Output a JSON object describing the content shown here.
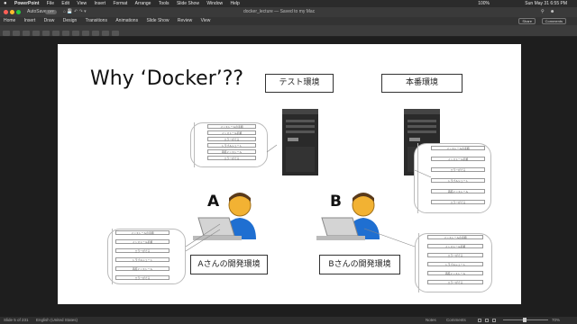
{
  "menubar": {
    "apple": "",
    "app": "PowerPoint",
    "items": [
      "File",
      "Edit",
      "View",
      "Insert",
      "Format",
      "Arrange",
      "Tools",
      "Slide Show",
      "Window",
      "Help"
    ],
    "clock": "Sun May 31 6:55 PM",
    "battery": "100%"
  },
  "titlebar": {
    "autosave": "AutoSave",
    "toggle": "OFF",
    "doc_title": "docker_lecture — Saved to my Mac",
    "share": "Share",
    "comments": "Comments"
  },
  "ribbon": {
    "tabs": [
      "Home",
      "Insert",
      "Draw",
      "Design",
      "Transitions",
      "Animations",
      "Slide Show",
      "Review",
      "View"
    ]
  },
  "slide": {
    "title": "Why ‘Docker’??",
    "env_test": "テスト環境",
    "env_prod": "本番環境",
    "dev_a_label": "Aさんの開発環境",
    "dev_b_label": "Bさんの開発環境",
    "letter_a": "A",
    "letter_b": "B",
    "steps": [
      "インストールの手順",
      "インストール手順",
      "エラーがでる",
      "トラブルシュート",
      "再度インストール",
      "エラーがでる"
    ]
  },
  "status": {
    "slide_counter": "Slide 5 of 231",
    "language": "English (United States)",
    "notes": "Notes",
    "comments": "Comments",
    "zoom": "70%"
  }
}
